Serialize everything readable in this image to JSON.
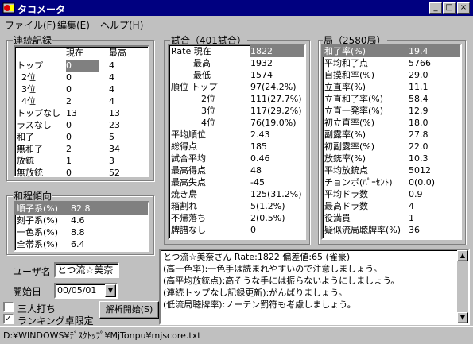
{
  "window": {
    "title": "タコメータ"
  },
  "menu": [
    "ファイル(F)",
    "編集(E)",
    "ヘルプ(H)"
  ],
  "renzoku": {
    "title": "連続記録",
    "headers": [
      "現在",
      "最高"
    ],
    "rows": [
      {
        "label": "トップ",
        "now": "0",
        "max": "4"
      },
      {
        "label": "2位",
        "now": "0",
        "max": "4"
      },
      {
        "label": "3位",
        "now": "0",
        "max": "4"
      },
      {
        "label": "4位",
        "now": "2",
        "max": "4"
      },
      {
        "label": "トップなし",
        "now": "13",
        "max": "13"
      },
      {
        "label": "ラスなし",
        "now": "0",
        "max": "23"
      },
      {
        "label": "和了",
        "now": "0",
        "max": "5"
      },
      {
        "label": "無和了",
        "now": "2",
        "max": "34"
      },
      {
        "label": "放銃",
        "now": "1",
        "max": "3"
      },
      {
        "label": "無放銃",
        "now": "0",
        "max": "52"
      }
    ]
  },
  "wasei": {
    "title": "和程傾向",
    "rows": [
      {
        "label": "順子系(%)",
        "value": "82.8"
      },
      {
        "label": "刻子系(%)",
        "value": "4.6"
      },
      {
        "label": "一色系(%)",
        "value": "8.8"
      },
      {
        "label": "全帯系(%)",
        "value": "6.4"
      }
    ]
  },
  "shiai": {
    "title": "試合（401試合）",
    "rows": [
      {
        "label": "Rate 現在",
        "value": "1822"
      },
      {
        "label": "最高",
        "value": "1932"
      },
      {
        "label": "最低",
        "value": "1574"
      },
      {
        "label": "順位 トップ",
        "value": "97(24.2%)"
      },
      {
        "label": "2位",
        "value": "111(27.7%)"
      },
      {
        "label": "3位",
        "value": "117(29.2%)"
      },
      {
        "label": "4位",
        "value": "76(19.0%)"
      },
      {
        "label": "平均順位",
        "value": "2.43"
      },
      {
        "label": "総得点",
        "value": "185"
      },
      {
        "label": "試合平均",
        "value": "0.46"
      },
      {
        "label": "最高得点",
        "value": "48"
      },
      {
        "label": "最高失点",
        "value": "-45"
      },
      {
        "label": "焼き鳥",
        "value": "125(31.2%)"
      },
      {
        "label": "箱割れ",
        "value": "5(1.2%)"
      },
      {
        "label": "不帰落ち",
        "value": "2(0.5%)"
      },
      {
        "label": "牌譜なし",
        "value": "0"
      }
    ]
  },
  "kyoku": {
    "title": "局（2580局）",
    "rows": [
      {
        "label": "和了率(%)",
        "value": "19.4"
      },
      {
        "label": "平均和了点",
        "value": "5766"
      },
      {
        "label": "自摸和率(%)",
        "value": "29.0"
      },
      {
        "label": "立直率(%)",
        "value": "11.1"
      },
      {
        "label": "立直和了率(%)",
        "value": "58.4"
      },
      {
        "label": "立直一発率(%)",
        "value": "12.9"
      },
      {
        "label": "初立直率(%)",
        "value": "18.0"
      },
      {
        "label": "副露率(%)",
        "value": "27.8"
      },
      {
        "label": "初副露率(%)",
        "value": "22.0"
      },
      {
        "label": "放銃率(%)",
        "value": "10.3"
      },
      {
        "label": "平均放銃点",
        "value": "5012"
      },
      {
        "label": "チョンボ(ﾊﾟｰｾﾝﾄ)",
        "value": "0(0.0)"
      },
      {
        "label": "平均ドラ数",
        "value": "0.9"
      },
      {
        "label": "最高ドラ数",
        "value": "4"
      },
      {
        "label": "役満貫",
        "value": "1"
      },
      {
        "label": "疑似流局聴牌率(%)",
        "value": "36"
      }
    ]
  },
  "user": {
    "label": "ユーザ名",
    "value": "とつ流☆美奈"
  },
  "start": {
    "label": "開始日",
    "value": "00/05/01"
  },
  "options": {
    "sannin": {
      "label": "三人打ち",
      "checked": false
    },
    "ranking": {
      "label": "ランキング卓限定",
      "checked": true
    }
  },
  "analyze_button": "解析開始(S)",
  "advice": [
    "とつ流☆美奈さん Rate:1822 偏差値:65 (雀豪)",
    "(高一色率):一色手は読まれやすいので注意しましょう。",
    "(高平均放銃点):高そうな手には振らないようにしましょう。",
    "(連続トップなし記録更新):がんばりましょう。",
    "(低流局聴牌率):ノーテン罰符も考慮しましょう。"
  ],
  "status": "D:¥WINDOWS¥ﾃﾞｽｸﾄｯﾌﾟ¥MjTonpu¥mjscore.txt"
}
